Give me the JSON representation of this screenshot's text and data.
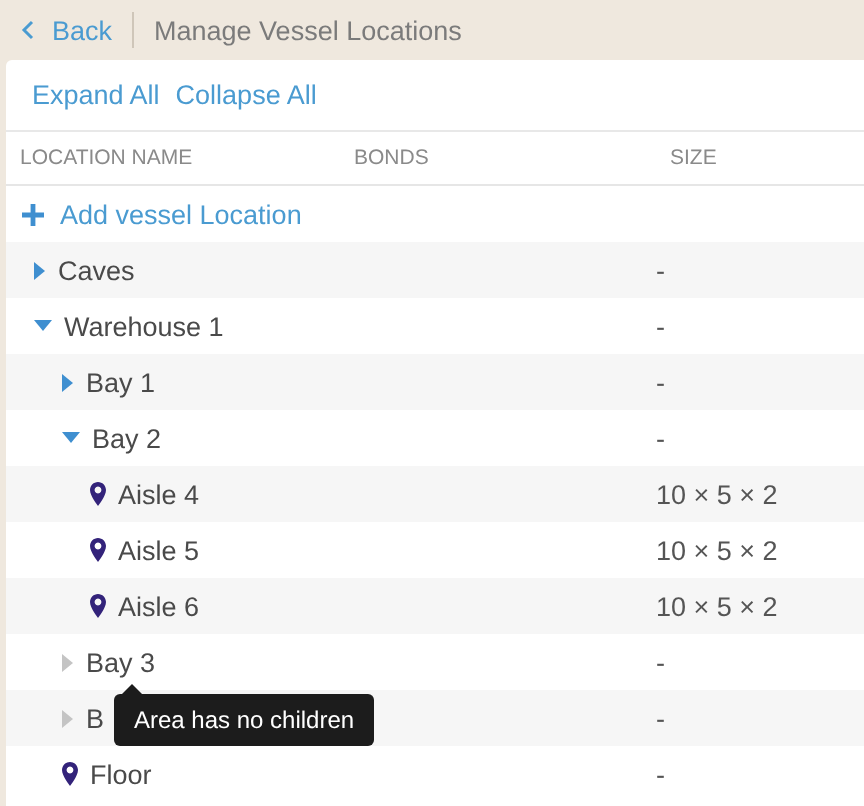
{
  "header": {
    "back": "Back",
    "title": "Manage Vessel Locations"
  },
  "actions": [
    "Expand All",
    "Collapse All"
  ],
  "table": {
    "columns": [
      "LOCATION NAME",
      "BONDS",
      "SIZE"
    ],
    "add_label": "Add vessel Location",
    "rows": [
      {
        "kind": "area",
        "name": "Caves",
        "size": "-",
        "expanded": false,
        "disabled": false
      },
      {
        "kind": "area",
        "name": "Warehouse 1",
        "size": "-",
        "expanded": true,
        "disabled": false,
        "children": [
          {
            "kind": "area",
            "name": "Bay 1",
            "size": "-",
            "expanded": false,
            "disabled": false
          },
          {
            "kind": "area",
            "name": "Bay 2",
            "size": "-",
            "expanded": true,
            "disabled": false,
            "children": [
              {
                "kind": "vessel",
                "name": "Aisle 4",
                "size": "10 × 5 × 2"
              },
              {
                "kind": "vessel",
                "name": "Aisle 5",
                "size": "10 × 5 × 2"
              },
              {
                "kind": "vessel",
                "name": "Aisle 6",
                "size": "10 × 5 × 2"
              }
            ]
          },
          {
            "kind": "area",
            "name": "Bay 3",
            "size": "-",
            "expanded": false,
            "disabled": true
          },
          {
            "kind": "area",
            "name": "B",
            "size": "-",
            "expanded": false,
            "disabled": true
          },
          {
            "kind": "vessel",
            "name": "Floor",
            "size": "-"
          }
        ]
      }
    ]
  },
  "tooltip": {
    "text": "Area has no children"
  }
}
